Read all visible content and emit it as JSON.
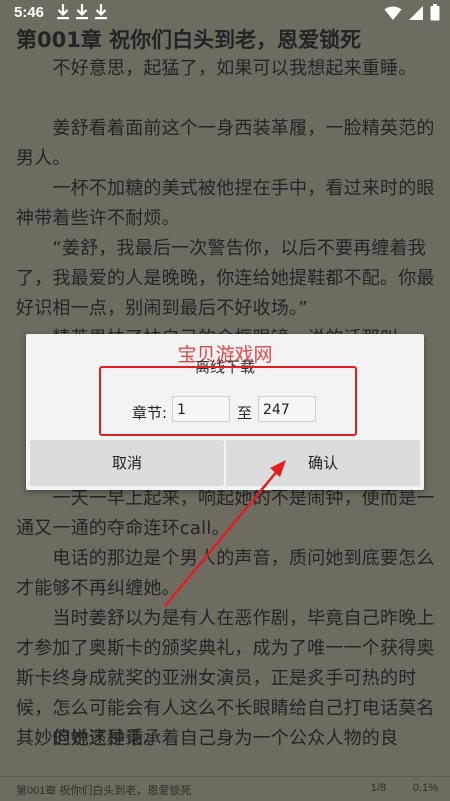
{
  "status_bar": {
    "time": "5:46",
    "icons": [
      "download-icon",
      "download-icon",
      "download-icon",
      "wifi-icon",
      "signal-icon",
      "battery-icon"
    ]
  },
  "reader": {
    "chapter_title": "第001章 祝你们白头到老，恩爱锁死",
    "paragraphs": [
      "　　不好意思，起猛了，如果可以我想起来重睡。",
      "　　姜舒看着面前这个一身西装革履，一脸精英范的男人。",
      "　　一杯不加糖的美式被他捏在手中，看过来时的眼神带着些许不耐烦。",
      "　　“姜舒，我最后一次警告你，以后不要再缠着我了，我最爱的人是晚晚，你连给她提鞋都不配。你最好识相一点，别闹到最后不好收场。”",
      "　　精英男扶了扶自己的金框眼镜，说的话那叫一",
      "　　一天一早上起来，响起她的不是闹钟，便而是一通又一通的夺命连环call。",
      "　　电话的那边是个男人的声音，质问她到底要怎么才能够不再纠缠她。",
      "　　当时姜舒以为是有人在恶作剧，毕竟自己昨晚上才参加了奥斯卡的颁奖典礼，成为了唯一一个获得奥斯卡终身成就奖的亚洲女演员，正是炙手可热的时候，怎么可能会有人这么不长眼睛给自己打电话莫名其妙的说这种话。",
      "　　但她还是秉承着自己身为一个公众人物的良"
    ]
  },
  "footer": {
    "chapter": "第001章 祝你们白头到老，恩爱锁死",
    "page": "1/8",
    "percent": "0.1%"
  },
  "dialog": {
    "watermark": "宝贝游戏网",
    "title": "离线下载",
    "chapter_label": "章节:",
    "from_value": "1",
    "to_label": "至",
    "to_value": "247",
    "cancel_label": "取消",
    "confirm_label": "确认"
  },
  "colors": {
    "dim_background": "#6e6b60",
    "dialog_bg": "#f3f3f3",
    "button_bg": "#dcdcdc",
    "annotation_red": "#e02020"
  }
}
